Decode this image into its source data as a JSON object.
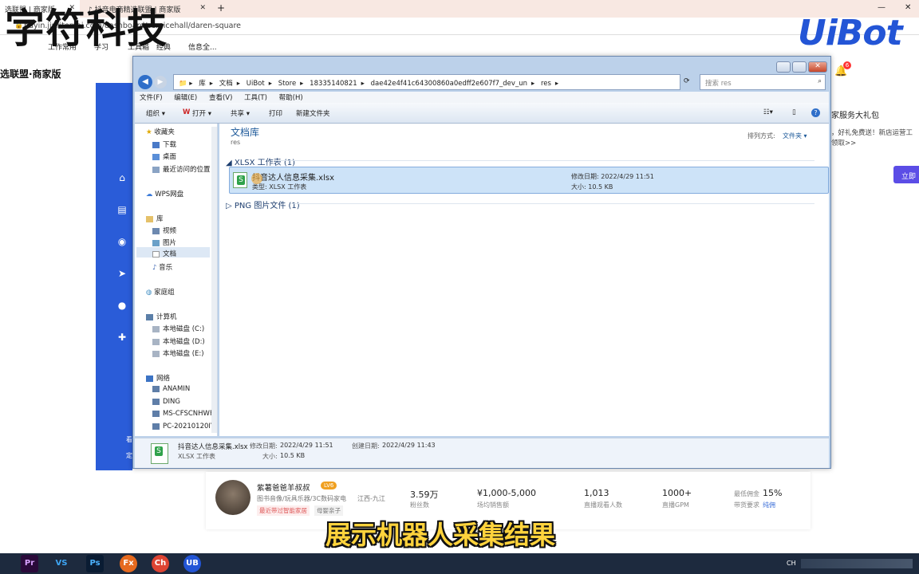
{
  "browser": {
    "tabs": [
      {
        "label": "选联盟 | 商家版",
        "close": "✕"
      },
      {
        "label": "抖音电商精选联盟 | 商家版",
        "close": "✕"
      }
    ],
    "new_tab": "+",
    "address": "buyin.jinritemai.com/dashboard/servicehall/daren-square",
    "bookmarks": [
      "工作常用",
      "学习",
      "工具箱",
      "经典",
      "信息全..."
    ],
    "window_controls": {
      "minimize": "—",
      "close": "✕"
    }
  },
  "watermark_text": "字符科技",
  "brand_logo": "UiBot",
  "site": {
    "title": "选联盟·商家版",
    "notification_count": "6",
    "promo_title": "家服务大礼包",
    "promo_text": "，好礼免费送！新店运营工",
    "promo_link": "领取>>",
    "promo_button": "立即",
    "side_label_1": "看",
    "side_label_2": "定"
  },
  "explorer": {
    "breadcrumb": [
      "库",
      "文档",
      "UiBot",
      "Store",
      "18335140821",
      "dae42e4f41c64300860a0edff2e607f7_dev_un",
      "res"
    ],
    "search_placeholder": "搜索 res",
    "menu": [
      "文件(F)",
      "编辑(E)",
      "查看(V)",
      "工具(T)",
      "帮助(H)"
    ],
    "toolbar": [
      "组织 ▾",
      "打开 ▾",
      "共享 ▾",
      "打印",
      "新建文件夹"
    ],
    "sidebar": {
      "favorites_title": "收藏夹",
      "favorites": [
        "下载",
        "桌面",
        "最近访问的位置"
      ],
      "wps": "WPS网盘",
      "library_title": "库",
      "libraries": [
        "视频",
        "图片",
        "文档",
        "音乐"
      ],
      "homegroup": "家庭组",
      "computer_title": "计算机",
      "drives": [
        "本地磁盘 (C:)",
        "本地磁盘 (D:)",
        "本地磁盘 (E:)"
      ],
      "network_title": "网络",
      "network": [
        "ANAMIN",
        "DING",
        "MS-CFSCNHWF",
        "PC-20210120IY("
      ]
    },
    "library_title": "文档库",
    "library_sub": "res",
    "sort_label": "排列方式:",
    "sort_value": "文件夹 ▾",
    "groups": [
      {
        "label": "XLSX 工作表 (1)"
      },
      {
        "label": "PNG 图片文件 (1)"
      }
    ],
    "file": {
      "name": "抖音达人信息采集.xlsx",
      "type_line": "类型: XLSX 工作表",
      "modified_line": "修改日期: 2022/4/29 11:51",
      "size_line": "大小: 10.5 KB"
    },
    "details": {
      "name": "抖音达人信息采集.xlsx",
      "modified_label": "修改日期:",
      "modified": "2022/4/29 11:51",
      "created_label": "创建日期:",
      "created": "2022/4/29 11:43",
      "type": "XLSX 工作表",
      "size_label": "大小:",
      "size": "10.5 KB"
    }
  },
  "influencer": {
    "name": "紫薯爸爸羊叔叔",
    "level": "LV6",
    "categories": "图书音像/玩具乐器/3C数码家电",
    "location": "江西-九江",
    "tag1": "最近带过智能家居",
    "tag2": "母婴亲子",
    "stats": [
      {
        "value": "3.59万",
        "label": "粉丝数"
      },
      {
        "value": "¥1,000-5,000",
        "label": "场均销售额"
      },
      {
        "value": "1,013",
        "label": "直播观看人数"
      },
      {
        "value": "1000+",
        "label": "直播GPM"
      }
    ],
    "commission_label": "最低佣金",
    "commission_value": "15%",
    "req_label": "带货要求",
    "req_value": "纯佣"
  },
  "subtitle": "展示机器人采集结果",
  "taskbar": {
    "apps": [
      "Pr",
      "VS",
      "Ps",
      "Fx",
      "Ch",
      "UB"
    ],
    "tray_text": "CH"
  },
  "colors": {
    "blue_panel": "#2a5cd8",
    "explorer_frame": "#bcd1ea",
    "subtitle": "#ffd33c",
    "uibot": "#2355d6"
  }
}
